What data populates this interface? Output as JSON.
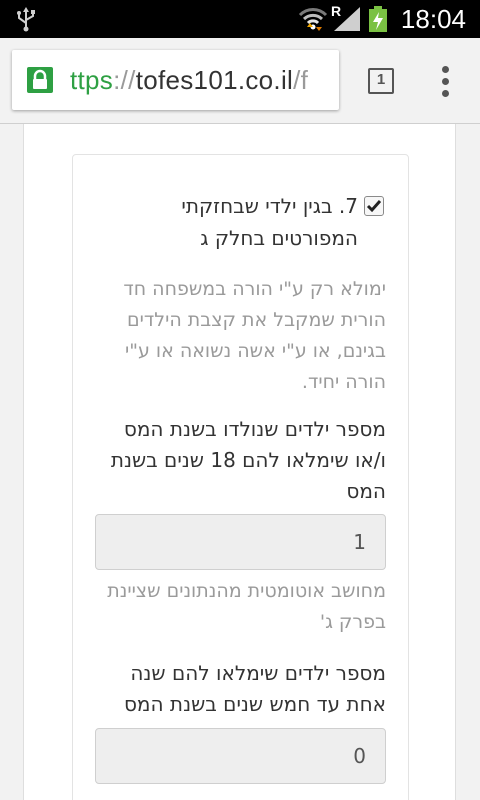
{
  "status_bar": {
    "time": "18:04",
    "network_letter": "R"
  },
  "browser": {
    "url_scheme": "ttps",
    "url_separator": "://",
    "url_host": "tofes101.co.il",
    "url_rest": "/f",
    "tab_count": "1",
    "secure_color": "#2ea043"
  },
  "form": {
    "checkbox_checked": true,
    "checkbox_label": "7. בגין ילדי שבחזקתי המפורטים בחלק ג",
    "note_1": "ימולא רק ע\"י הורה במשפחה חד הורית שמקבל את קצבת הילדים בגינם, או ע\"י אשה נשואה או ע\"י הורה יחיד.",
    "field_1_label": "מספר ילדים שנולדו בשנת המס ו/או שימלאו להם 18 שנים בשנת המס",
    "field_1_value": "1",
    "note_2": "מחושב אוטומטית מהנתונים שציינת בפרק ג'",
    "field_2_label": "מספר ילדים שימלאו להם שנה אחת עד חמש שנים בשנת המס",
    "field_2_value": "0"
  }
}
